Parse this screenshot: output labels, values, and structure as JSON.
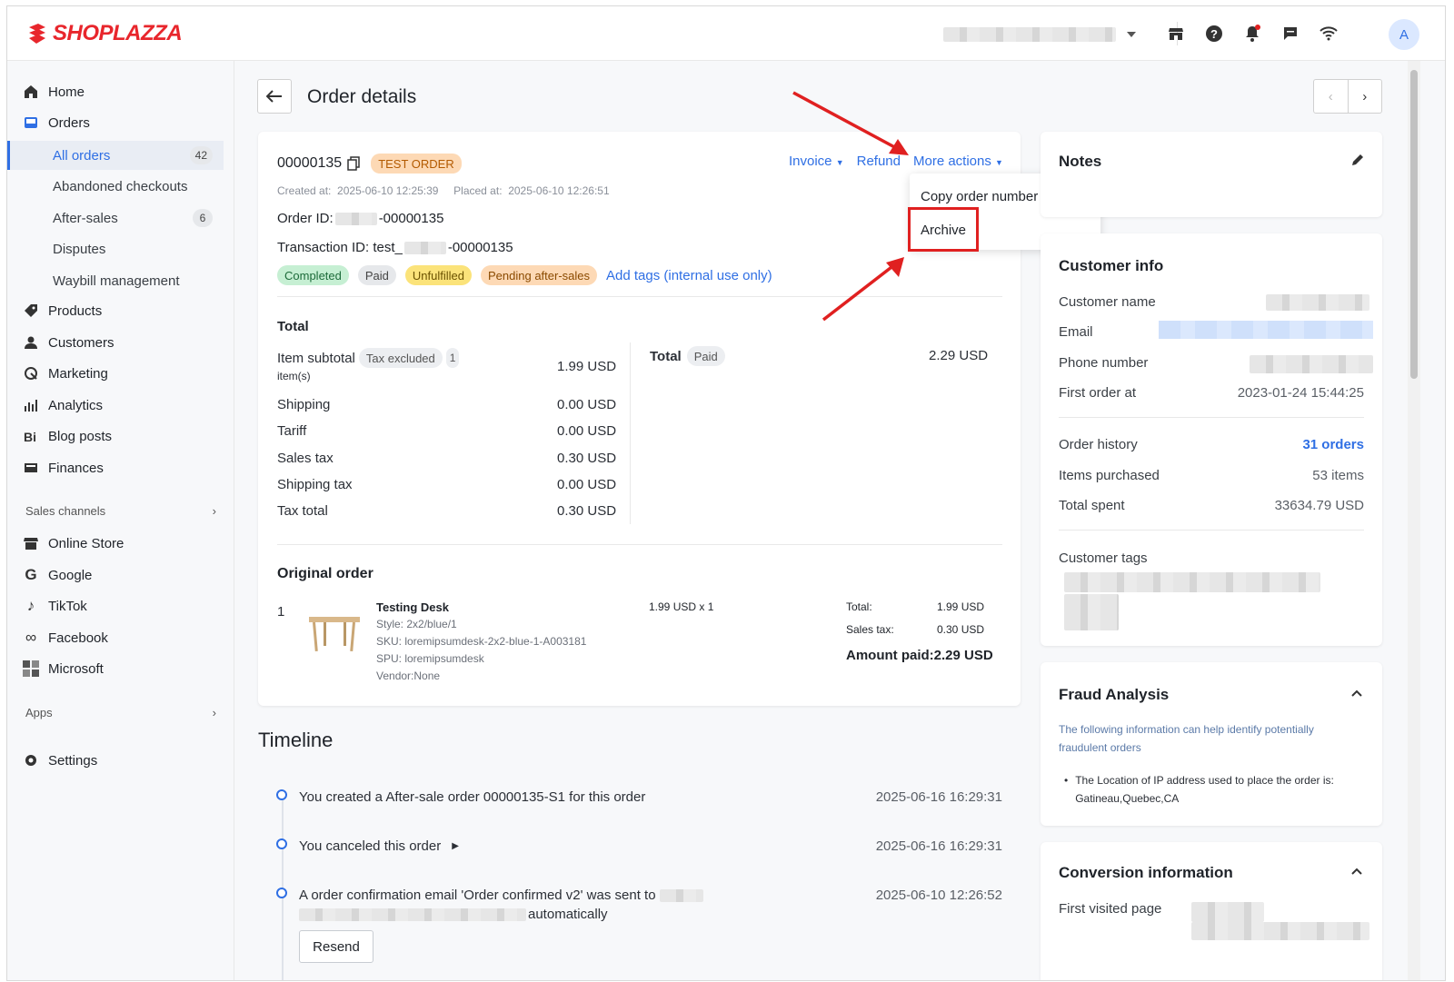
{
  "app": {
    "brand": "SHOPLAZZA",
    "avatar_initial": "A",
    "accent": "#2f6fe4",
    "brand_color": "#e8262c"
  },
  "topbar_icons": [
    "store-icon",
    "help-icon",
    "bell-icon",
    "chat-icon",
    "wifi-icon"
  ],
  "sidebar": {
    "home": "Home",
    "orders": "Orders",
    "all_orders": "All orders",
    "all_orders_count": "42",
    "abandoned": "Abandoned checkouts",
    "after_sales": "After-sales",
    "after_sales_count": "6",
    "disputes": "Disputes",
    "waybill": "Waybill management",
    "products": "Products",
    "customers": "Customers",
    "marketing": "Marketing",
    "analytics": "Analytics",
    "blog": "Blog posts",
    "finances": "Finances",
    "sales_channels": "Sales channels",
    "online_store": "Online Store",
    "google": "Google",
    "tiktok": "TikTok",
    "facebook": "Facebook",
    "microsoft": "Microsoft",
    "apps": "Apps",
    "settings": "Settings"
  },
  "page": {
    "title": "Order details"
  },
  "order": {
    "number": "00000135",
    "test_badge": "TEST ORDER",
    "invoice": "Invoice",
    "refund": "Refund",
    "more_actions": "More actions",
    "created_label": "Created at:",
    "created_at": "2025-06-10 12:25:39",
    "placed_label": "Placed at:",
    "placed_at": "2025-06-10 12:26:51",
    "order_id_label": "Order ID:",
    "order_id_suffix": "-00000135",
    "txn_label": "Transaction ID: test_",
    "txn_suffix": "-00000135",
    "tags": {
      "completed": "Completed",
      "paid": "Paid",
      "unfulfilled": "Unfulfilled",
      "pending": "Pending after-sales"
    },
    "add_tags": "Add tags (internal use only)"
  },
  "menu": {
    "copy": "Copy order number",
    "archive": "Archive"
  },
  "totals": {
    "heading": "Total",
    "item_subtotal": "Item subtotal",
    "tax_excluded": "Tax excluded",
    "items_count": "1",
    "items_unit": "item(s)",
    "item_subtotal_val": "1.99 USD",
    "shipping": "Shipping",
    "shipping_val": "0.00 USD",
    "tariff": "Tariff",
    "tariff_val": "0.00 USD",
    "sales_tax": "Sales tax",
    "sales_tax_val": "0.30 USD",
    "shipping_tax": "Shipping tax",
    "shipping_tax_val": "0.00 USD",
    "tax_total": "Tax total",
    "tax_total_val": "0.30 USD",
    "total": "Total",
    "paid": "Paid",
    "total_val": "2.29 USD"
  },
  "original_order": {
    "heading": "Original order",
    "qty": "1",
    "name": "Testing Desk",
    "style": "Style: 2x2/blue/1",
    "sku": "SKU: loremipsumdesk-2x2-blue-1-A003181",
    "spu": "SPU: loremipsumdesk",
    "vendor": "Vendor:None",
    "price": "1.99 USD x 1",
    "total_label": "Total:",
    "total_val": "1.99 USD",
    "tax_label": "Sales tax:",
    "tax_val": "0.30 USD",
    "amount_paid": "Amount paid:2.29 USD"
  },
  "timeline": {
    "heading": "Timeline",
    "events": [
      {
        "text": "You created a After-sale order 00000135-S1 for this order",
        "time": "2025-06-16 16:29:31"
      },
      {
        "text": "You canceled this order",
        "time": "2025-06-16 16:29:31"
      },
      {
        "text": "A order confirmation email 'Order confirmed v2' was sent to",
        "text2": "automatically",
        "time": "2025-06-10 12:26:52"
      }
    ],
    "resend": "Resend"
  },
  "notes": {
    "title": "Notes"
  },
  "customer": {
    "title": "Customer info",
    "name_label": "Customer name",
    "email_label": "Email",
    "phone_label": "Phone number",
    "first_order_label": "First order at",
    "first_order_val": "2023-01-24 15:44:25",
    "history_label": "Order history",
    "history_val": "31 orders",
    "items_label": "Items purchased",
    "items_val": "53 items",
    "spent_label": "Total spent",
    "spent_val": "33634.79 USD",
    "tags_label": "Customer tags"
  },
  "fraud": {
    "title": "Fraud Analysis",
    "desc": "The following information can help identify potentially fraudulent orders",
    "bullet": "The Location of IP address used to place the order is: Gatineau,Quebec,CA"
  },
  "conversion": {
    "title": "Conversion information",
    "first_visited": "First visited page"
  }
}
